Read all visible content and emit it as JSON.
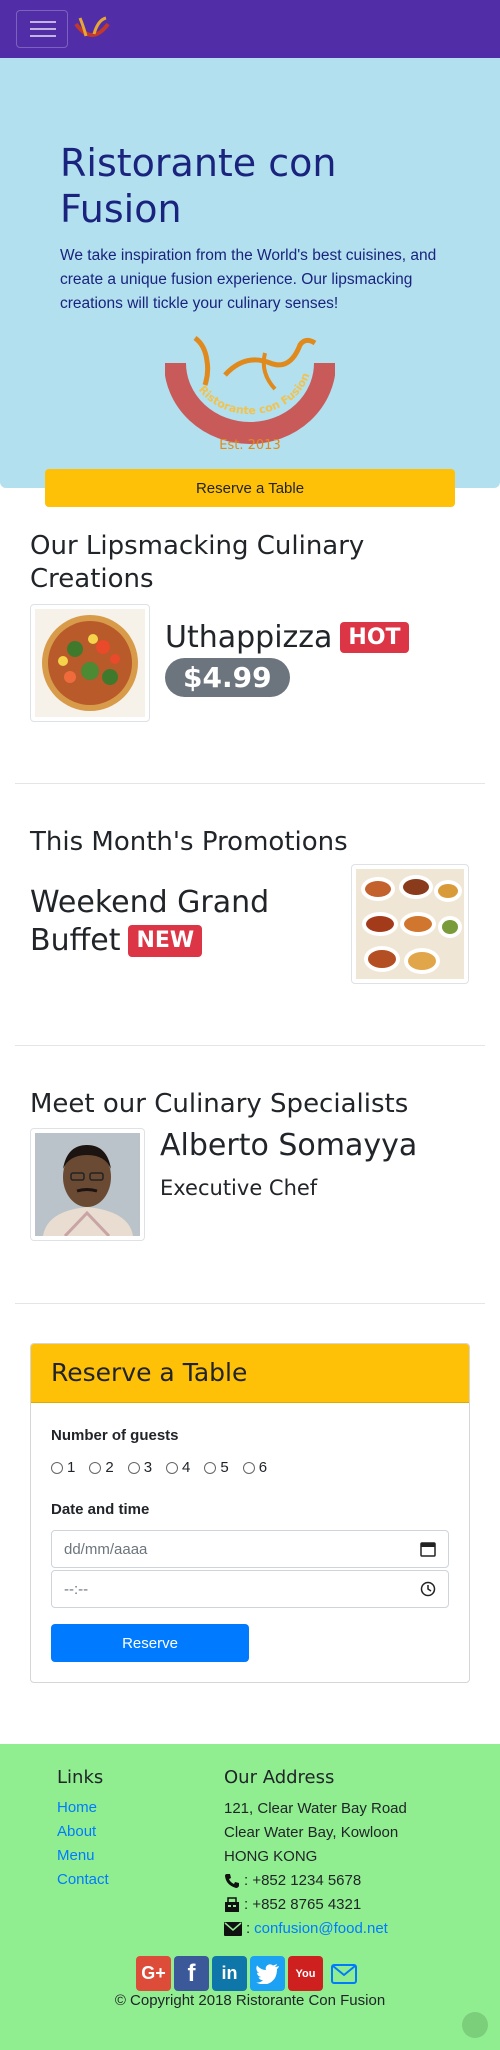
{
  "brand": {
    "name": "Ristorante con Fusion",
    "logo_ribbon": "Ristorante con Fusion",
    "logo_est": "Est. 2013"
  },
  "jumbotron": {
    "title": "Ristorante con Fusion",
    "text": "We take inspiration from the World's best cuisines, and create a unique fusion experience. Our lipsmacking creations will tickle your culinary senses!",
    "reserve_button": "Reserve a Table"
  },
  "dish": {
    "section_title": "Our Lipsmacking Culinary Creations",
    "name": "Uthappizza",
    "badge": "HOT",
    "price": "$4.99"
  },
  "promotion": {
    "section_title": "This Month's Promotions",
    "name_line1": "Weekend Grand",
    "name_line2": "Buffet",
    "badge": "NEW"
  },
  "leader": {
    "section_title": "Meet our Culinary Specialists",
    "name": "Alberto Somayya",
    "designation": "Executive Chef"
  },
  "reservation": {
    "title": "Reserve a Table",
    "guests_label": "Number of guests",
    "guests_options": [
      "1",
      "2",
      "3",
      "4",
      "5",
      "6"
    ],
    "datetime_label": "Date and time",
    "date_placeholder": "dd/mm/aaaa",
    "time_placeholder": "--:--",
    "submit": "Reserve"
  },
  "footer": {
    "links_title": "Links",
    "links": [
      "Home",
      "About",
      "Menu",
      "Contact"
    ],
    "address_title": "Our Address",
    "address": [
      "121, Clear Water Bay Road",
      "Clear Water Bay, Kowloon",
      "HONG KONG"
    ],
    "phone": ": +852 1234 5678",
    "fax": ": +852 8765 4321",
    "email": "confusion@food.net",
    "email_prefix": ":",
    "copyright": "© Copyright 2018 Ristorante Con Fusion"
  },
  "icons": [
    "hamburger-icon",
    "logo",
    "phone-icon",
    "fax-icon",
    "envelope-icon",
    "google-plus-icon",
    "facebook-icon",
    "linkedin-icon",
    "twitter-icon",
    "youtube-icon",
    "mail-icon"
  ],
  "colors": {
    "navbar": "#512DA8",
    "jumbotron": "#B2E0EE",
    "accent": "#FFC107",
    "footer": "#90EE90",
    "primary": "#007bff",
    "danger": "#dc3545"
  }
}
